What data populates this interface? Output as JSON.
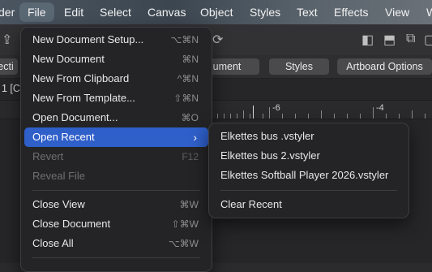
{
  "menubar": {
    "items": [
      "der",
      "File",
      "Edit",
      "Select",
      "Canvas",
      "Object",
      "Styles",
      "Text",
      "Effects",
      "View",
      "W"
    ],
    "active": "File"
  },
  "tabbar": {
    "left_fragment": "ecti",
    "pills": [
      "ument",
      "Styles",
      "Artboard Options"
    ]
  },
  "document_row": {
    "label": "1 [C"
  },
  "ruler": {
    "labels": [
      "-6",
      "-4"
    ]
  },
  "file_menu": {
    "items": [
      {
        "label": "New Document Setup...",
        "shortcut": "⌥⌘N"
      },
      {
        "label": "New Document",
        "shortcut": "⌘N"
      },
      {
        "label": "New From Clipboard",
        "shortcut": "^⌘N"
      },
      {
        "label": "New From Template...",
        "shortcut": "⇧⌘N"
      },
      {
        "label": "Open Document...",
        "shortcut": "⌘O"
      },
      {
        "label": "Open Recent",
        "shortcut": ""
      },
      {
        "label": "Revert",
        "shortcut": "F12"
      },
      {
        "label": "Reveal File",
        "shortcut": ""
      },
      {
        "label": "Close View",
        "shortcut": "⌘W"
      },
      {
        "label": "Close Document",
        "shortcut": "⇧⌘W"
      },
      {
        "label": "Close All",
        "shortcut": "⌥⌘W"
      }
    ]
  },
  "open_recent_submenu": {
    "items": [
      "Elkettes bus .vstyler",
      "Elkettes bus 2.vstyler",
      "Elkettes Softball Player 2026.vstyler"
    ],
    "clear": "Clear Recent"
  },
  "colors": {
    "highlight": "#2f5fc9",
    "menu_bg": "#242426"
  }
}
